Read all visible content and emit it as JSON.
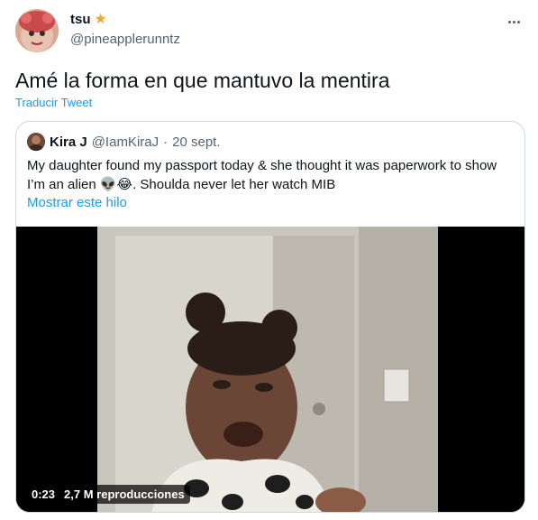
{
  "author": {
    "display_name": "tsu",
    "handle": "@pineapplerunntz",
    "badge_icon": "star-icon",
    "badge_color": "#f4a62a"
  },
  "tweet": {
    "text": "Amé la forma en que mantuvo la mentira",
    "translate_label": "Traducir Tweet"
  },
  "quoted": {
    "display_name": "Kira J",
    "handle": "@IamKiraJ",
    "separator": "·",
    "date": "20 sept.",
    "text": "My daughter found my passport today & she thought it was paperwork to show I’m an alien 👽😂. Shoulda never let her watch MIB",
    "show_thread_label": "Mostrar este hilo"
  },
  "video": {
    "duration": "0:23",
    "views": "2,7 M reproducciones"
  },
  "colors": {
    "link": "#1d9bf0",
    "secondary_text": "#536471",
    "border": "#cfd9de"
  }
}
